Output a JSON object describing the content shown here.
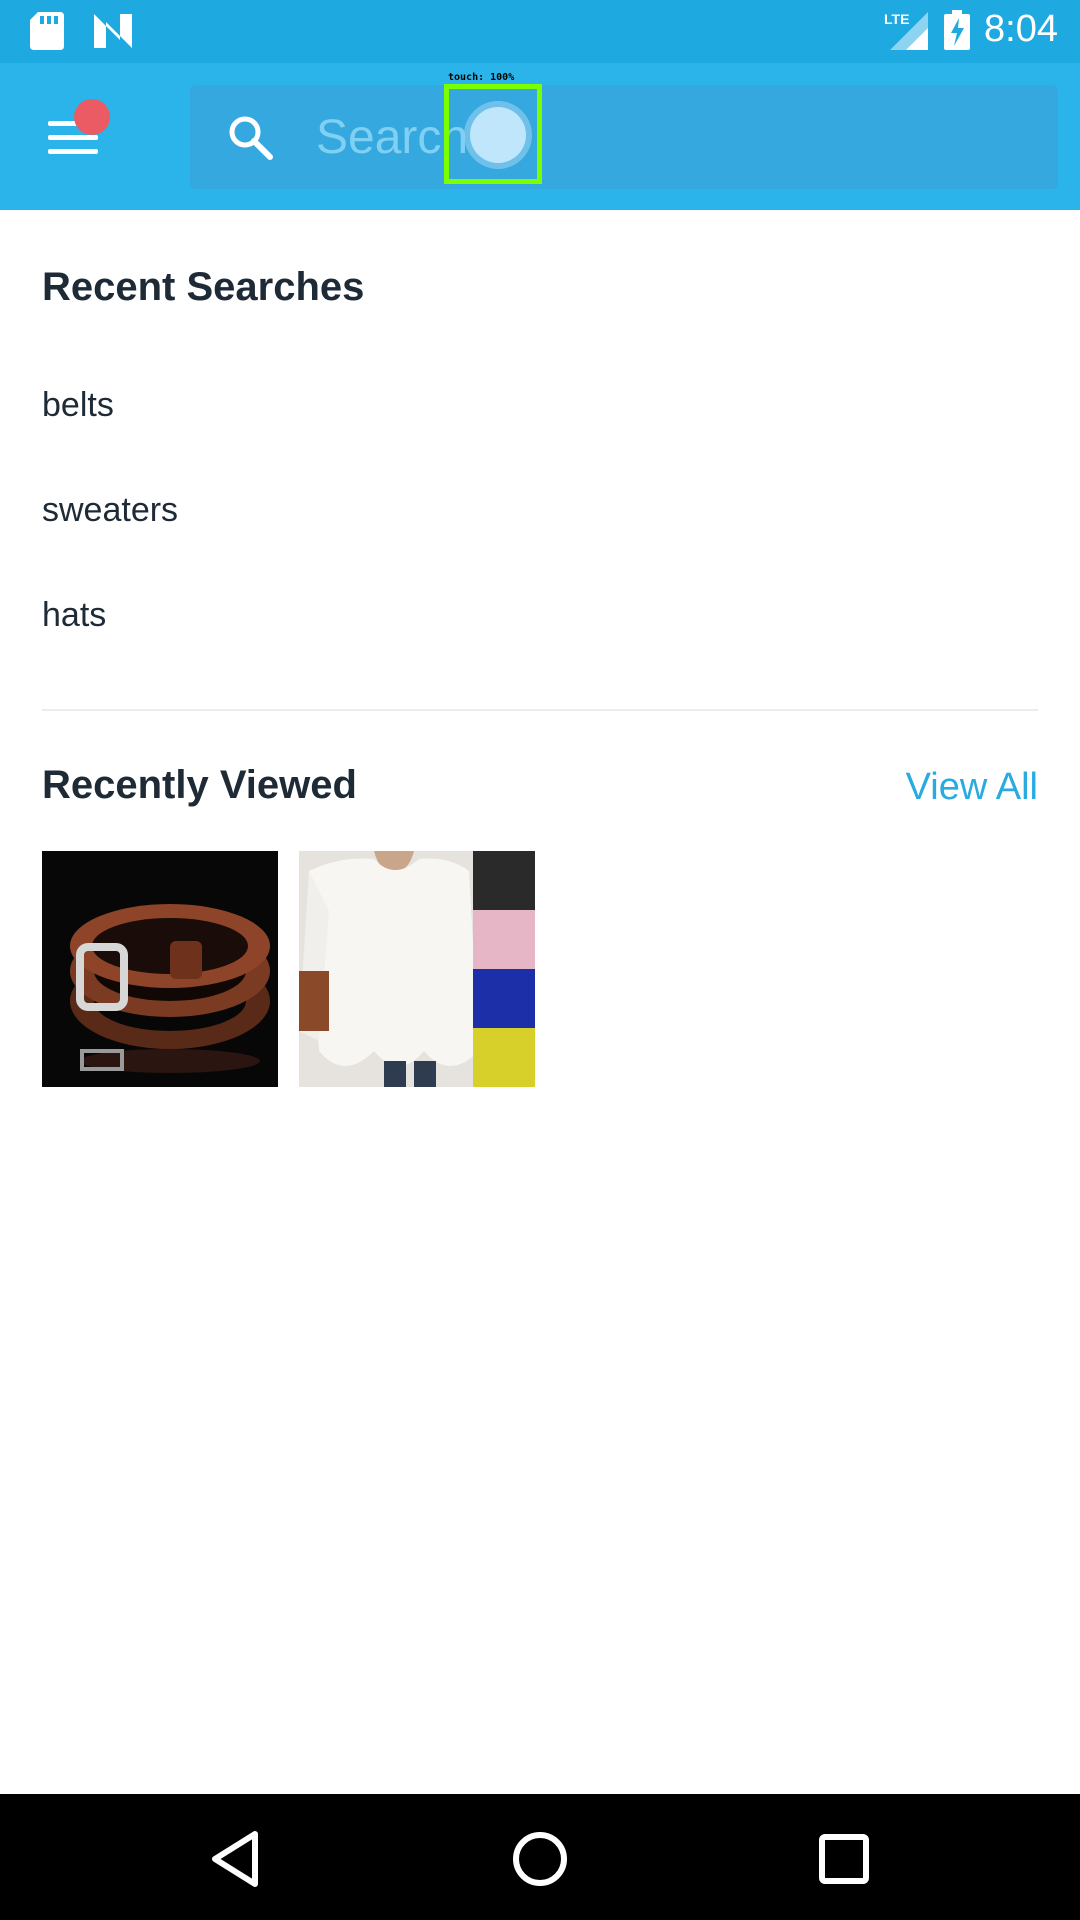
{
  "status_bar": {
    "time": "8:04",
    "network": "LTE",
    "icons": [
      "sd-card-icon",
      "n-logo-icon",
      "lte-signal-icon",
      "battery-charging-icon"
    ]
  },
  "app_bar": {
    "menu_icon": "hamburger-menu-icon",
    "search_placeholder": "Search",
    "touch_overlay_label": "touch: 100%",
    "colors": {
      "app_bar": "#2bb4ea",
      "status_bar": "#1fa9e1",
      "notification_dot": "#ea5b63"
    }
  },
  "recent_searches": {
    "title": "Recent Searches",
    "items": [
      "belts",
      "sweaters",
      "hats"
    ]
  },
  "recently_viewed": {
    "title": "Recently Viewed",
    "view_all_label": "View All",
    "items": [
      {
        "name": "brown-leather-belt-image"
      },
      {
        "name": "white-knit-sweater-image"
      }
    ]
  },
  "nav_bar": {
    "buttons": [
      "back-icon",
      "home-icon",
      "recents-icon"
    ]
  }
}
